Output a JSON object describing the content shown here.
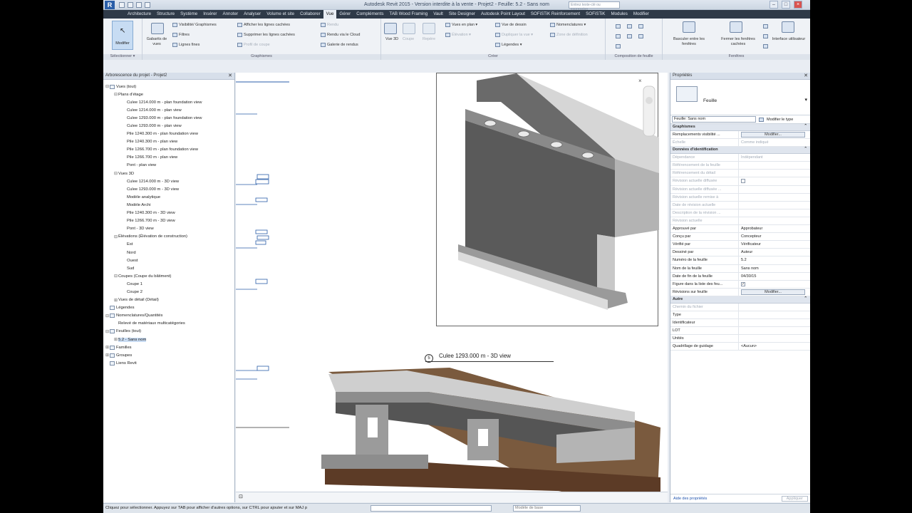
{
  "window": {
    "title": "Autodesk Revit 2015 - Version interdite à la vente -    Projet2 - Feuille: 5.2 - Sans nom",
    "search_placeholder": "Entrez texte-clé ou expression",
    "controls": [
      "–",
      "□",
      "×"
    ]
  },
  "tabs": [
    "Architecture",
    "Structure",
    "Système",
    "Insérer",
    "Annoter",
    "Analyser",
    "Volume et site",
    "Collaborer",
    "Vue",
    "Gérer",
    "Compléments",
    "TAB Wood Framing",
    "Vault",
    "Site Designer",
    "Autodesk Point Layout",
    "SOFiSTiK Reinforcement",
    "SOFiSTiK",
    "Modules",
    "Modifier"
  ],
  "active_tab": "Vue",
  "ribbon": {
    "modify_label": "Modifier",
    "select_label": "Sélectionner ▾",
    "gabarits_label": "Gabarits de vues",
    "graphics_items": [
      "Visibilité/ Graphismes",
      "Filtres",
      "Lignes fines"
    ],
    "hidden_items": [
      "Afficher les lignes cachées",
      "Supprimer les lignes cachées",
      "Profil de coupe"
    ],
    "render_items": [
      "Rendu",
      "Rendu  via le Cloud",
      "Galerie  de rendus"
    ],
    "graphics_panel": "Graphismes",
    "view3d_label": "Vue 3D",
    "coupe_label": "Coupe",
    "repere_label": "Repère",
    "create_items": [
      "Vues en plan ▾",
      "Élévation ▾",
      "Vue de dessin",
      "Dupliquer la vue ▾",
      "Légendes ▾",
      "Nomenclatures ▾",
      "Zone de définition"
    ],
    "create_panel": "Créer",
    "sheet_panel": "Composition de feuille",
    "windows_items": [
      "Basculer entre les fenêtres",
      "Fermer les fenêtres cachées",
      "Interface utilisateur"
    ],
    "windows_panel": "Fenêtres"
  },
  "browser": {
    "title": "Arborescence du projet - Projet2",
    "nodes": [
      {
        "label": "Vues (tout)",
        "level": 0,
        "expander": "⊟",
        "icon": true
      },
      {
        "label": "Plans d'étage",
        "level": 1,
        "expander": "⊟"
      },
      {
        "label": "Culee  1214.000 m - plan foundation view",
        "level": 2
      },
      {
        "label": "Culee  1214.000 m - plan view",
        "level": 2
      },
      {
        "label": "Culee  1293.000 m - plan foundation view",
        "level": 2
      },
      {
        "label": "Culee  1293.000 m - plan view",
        "level": 2
      },
      {
        "label": "Pile  1240.300 m - plan foundation view",
        "level": 2
      },
      {
        "label": "Pile  1240.300 m - plan view",
        "level": 2
      },
      {
        "label": "Pile  1266.700 m - plan foundation view",
        "level": 2
      },
      {
        "label": "Pile  1266.700 m - plan view",
        "level": 2
      },
      {
        "label": "Pont - plan view",
        "level": 2
      },
      {
        "label": "Vues 3D",
        "level": 1,
        "expander": "⊟"
      },
      {
        "label": "Culee  1214.000 m - 3D view",
        "level": 2
      },
      {
        "label": "Culee  1293.000 m - 3D view",
        "level": 2
      },
      {
        "label": "Modèle analytique",
        "level": 2
      },
      {
        "label": "Modèle Archi",
        "level": 2
      },
      {
        "label": "Pile  1240.300 m - 3D view",
        "level": 2
      },
      {
        "label": "Pile  1266.700 m - 3D view",
        "level": 2
      },
      {
        "label": "Pont - 3D view",
        "level": 2
      },
      {
        "label": "Élévations (Élévation de construction)",
        "level": 1,
        "expander": "⊟"
      },
      {
        "label": "Est",
        "level": 2
      },
      {
        "label": "Nord",
        "level": 2
      },
      {
        "label": "Ouest",
        "level": 2
      },
      {
        "label": "Sud",
        "level": 2
      },
      {
        "label": "Coupes (Coupe du bâtiment)",
        "level": 1,
        "expander": "⊟"
      },
      {
        "label": "Coupe 1",
        "level": 2
      },
      {
        "label": "Coupe 2",
        "level": 2
      },
      {
        "label": "Vues de détail (Détail)",
        "level": 1,
        "expander": "⊞"
      },
      {
        "label": "Légendes",
        "level": 0,
        "icon": true
      },
      {
        "label": "Nomenclatures/Quantités",
        "level": 0,
        "expander": "⊟",
        "icon": true
      },
      {
        "label": "Relevé de matériaux multicatégories",
        "level": 1
      },
      {
        "label": "Feuilles (tout)",
        "level": 0,
        "expander": "⊟",
        "icon": true
      },
      {
        "label": "5.2 - Sans nom",
        "level": 1,
        "expander": "⊞",
        "selected": true
      },
      {
        "label": "Familles",
        "level": 0,
        "expander": "⊞",
        "icon": true
      },
      {
        "label": "Groupes",
        "level": 0,
        "expander": "⊞",
        "icon": true
      },
      {
        "label": "Liens Revit",
        "level": 0,
        "icon": true
      }
    ]
  },
  "canvas": {
    "view_number": "5",
    "view_title": "Culee  1293.000 m - 3D view",
    "tags": [
      "Pile 1240 m",
      "Pile 1266",
      "Culee 1214",
      "Culee 1293",
      "Pont",
      "Pile 1240"
    ]
  },
  "properties": {
    "title": "Propriétés",
    "type_name": "Feuille",
    "filter_value": "Feuille: Sans nom",
    "edit_type": "Modifier le type",
    "groups": [
      {
        "name": "Graphismes",
        "rows": [
          {
            "k": "Remplacements visibilité ...",
            "v": "Modifier...",
            "button": true
          },
          {
            "k": "Échelle",
            "v": "Comme indiqué",
            "dim": true
          }
        ]
      },
      {
        "name": "Données d'identification",
        "rows": [
          {
            "k": "Dépendance",
            "v": "Indépendant",
            "dim": true
          },
          {
            "k": "Référencement de la feuille",
            "v": "",
            "dim": true
          },
          {
            "k": "Référencement du détail",
            "v": "",
            "dim": true
          },
          {
            "k": "Révision actuelle diffusée",
            "v": "",
            "dim": true,
            "check": true
          },
          {
            "k": "Révision actuelle diffusée ...",
            "v": "",
            "dim": true
          },
          {
            "k": "Révision actuelle remise à",
            "v": "",
            "dim": true
          },
          {
            "k": "Date de révision actuelle",
            "v": "",
            "dim": true
          },
          {
            "k": "Description de la révision ...",
            "v": "",
            "dim": true
          },
          {
            "k": "Révision actuelle",
            "v": "",
            "dim": true
          },
          {
            "k": "Approuvé par",
            "v": "Approbateur"
          },
          {
            "k": "Conçu par",
            "v": "Concepteur"
          },
          {
            "k": "Vérifié par",
            "v": "Vérificateur"
          },
          {
            "k": "Dessiné par",
            "v": "Auteur"
          },
          {
            "k": "Numéro de la feuille",
            "v": "5.2"
          },
          {
            "k": "Nom de la feuille",
            "v": "Sans nom"
          },
          {
            "k": "Date de fin de la feuille",
            "v": "04/30/15"
          },
          {
            "k": "Figure dans la liste des feu...",
            "v": "",
            "check": true,
            "checked": true
          },
          {
            "k": "Révisions sur feuille",
            "v": "Modifier...",
            "button": true
          }
        ]
      },
      {
        "name": "Autre",
        "rows": [
          {
            "k": "Chemin du fichier",
            "v": "",
            "dim": true
          },
          {
            "k": "Type",
            "v": ""
          },
          {
            "k": "Identificateur",
            "v": ""
          },
          {
            "k": "LOT",
            "v": ""
          },
          {
            "k": "Unités",
            "v": ""
          },
          {
            "k": "Quadrillage de guidage",
            "v": "<Aucun>"
          }
        ]
      }
    ],
    "help_link": "Aide des propriétés",
    "apply": "Appliquer"
  },
  "status": {
    "text": "Cliquez pour sélectionner. Appuyez sur TAB pour afficher d'autres options, sur CTRL pour ajouter et sur MAJ p",
    "model_label": "Modèle de base"
  },
  "colors": {
    "accent": "#2a5ea8",
    "selection": "#c9dcf3",
    "tabbar": "#2f3a48"
  }
}
